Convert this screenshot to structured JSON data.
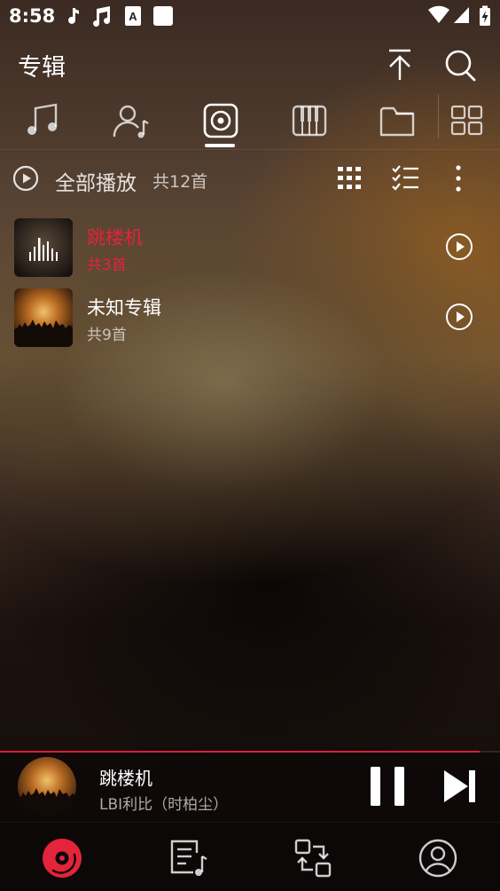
{
  "status_bar": {
    "time": "8:58",
    "icons": [
      "music-note-icon",
      "music-note-double-icon",
      "font-a-icon",
      "white-square-icon",
      "wifi-icon",
      "signal-icon",
      "battery-charging-icon"
    ]
  },
  "header": {
    "title": "专辑",
    "buttons": [
      "scroll-top-icon",
      "search-icon"
    ]
  },
  "tabs": [
    {
      "icon": "song-icon",
      "active": false
    },
    {
      "icon": "artist-icon",
      "active": false
    },
    {
      "icon": "album-icon",
      "active": true
    },
    {
      "icon": "piano-icon",
      "active": false
    },
    {
      "icon": "folder-icon",
      "active": false
    },
    {
      "icon": "grid-icon",
      "active": false
    }
  ],
  "toolbar": {
    "play_all_label": "全部播放",
    "count_label": "共12首",
    "icons": [
      "grid-view-icon",
      "multi-select-icon",
      "more-icon"
    ]
  },
  "albums": [
    {
      "name": "跳楼机",
      "count": "共3首",
      "playing": true
    },
    {
      "name": "未知专辑",
      "count": "共9首",
      "playing": false
    }
  ],
  "mini_player": {
    "title": "跳楼机",
    "artist": "LBI利比（时柏尘）",
    "progress": 0.96
  },
  "bottom_nav": [
    "disc-icon",
    "playlist-icon",
    "repeat-icon",
    "profile-icon"
  ],
  "colors": {
    "accent": "#e3243a",
    "background": "#140d0b"
  }
}
